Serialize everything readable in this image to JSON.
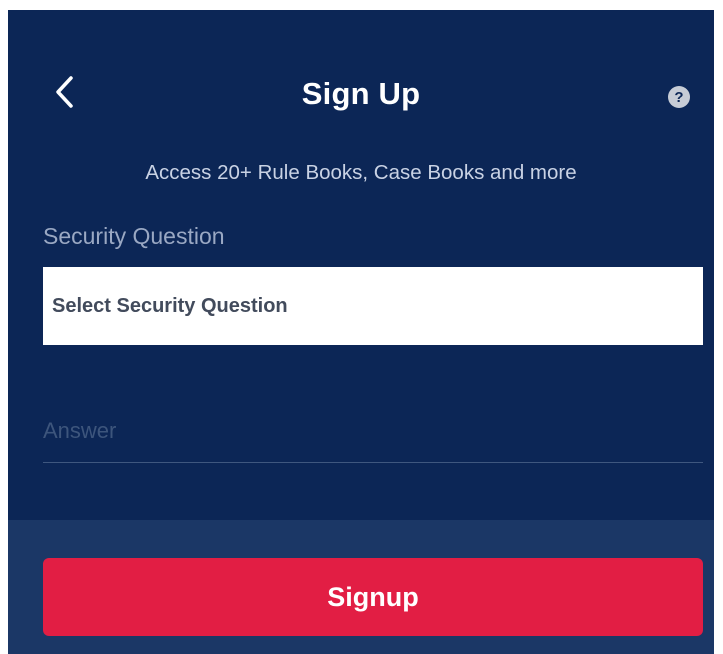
{
  "header": {
    "title": "Sign Up",
    "back_icon": "chevron-left-icon",
    "help_icon": "question-circle-icon",
    "help_glyph": "?"
  },
  "subtitle": "Access 20+ Rule Books, Case Books and more",
  "security": {
    "label": "Security Question",
    "select_value": "Select Security Question",
    "answer_placeholder": "Answer",
    "answer_value": ""
  },
  "footer": {
    "signup_label": "Signup"
  },
  "colors": {
    "background": "#0c2656",
    "footer_background": "#1b3766",
    "accent": "#e21e44",
    "text": "#ffffff"
  }
}
